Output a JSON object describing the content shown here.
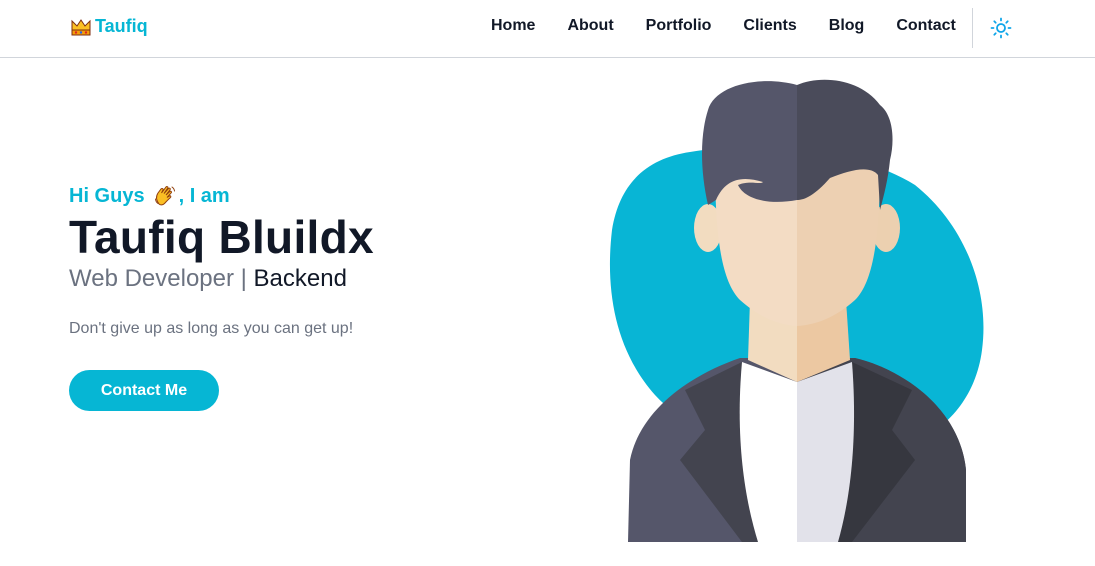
{
  "nav": {
    "brand": "Taufiq",
    "brand_icon": "crown-icon",
    "links": [
      "Home",
      "About",
      "Portfolio",
      "Clients",
      "Blog",
      "Contact"
    ],
    "theme_icon": "sun-icon"
  },
  "hero": {
    "greeting_prefix": "Hi Guys",
    "greeting_suffix": ", I am",
    "greeting_icon": "waving-hand-icon",
    "name": "Taufiq Bluildx",
    "role_main": "Web Developer | ",
    "role_accent": "Backend",
    "tagline": "Don't give up as long as you can get up!",
    "cta_label": "Contact Me"
  },
  "colors": {
    "accent": "#06b6d4",
    "text_dark": "#111827",
    "text_muted": "#6b7280"
  }
}
